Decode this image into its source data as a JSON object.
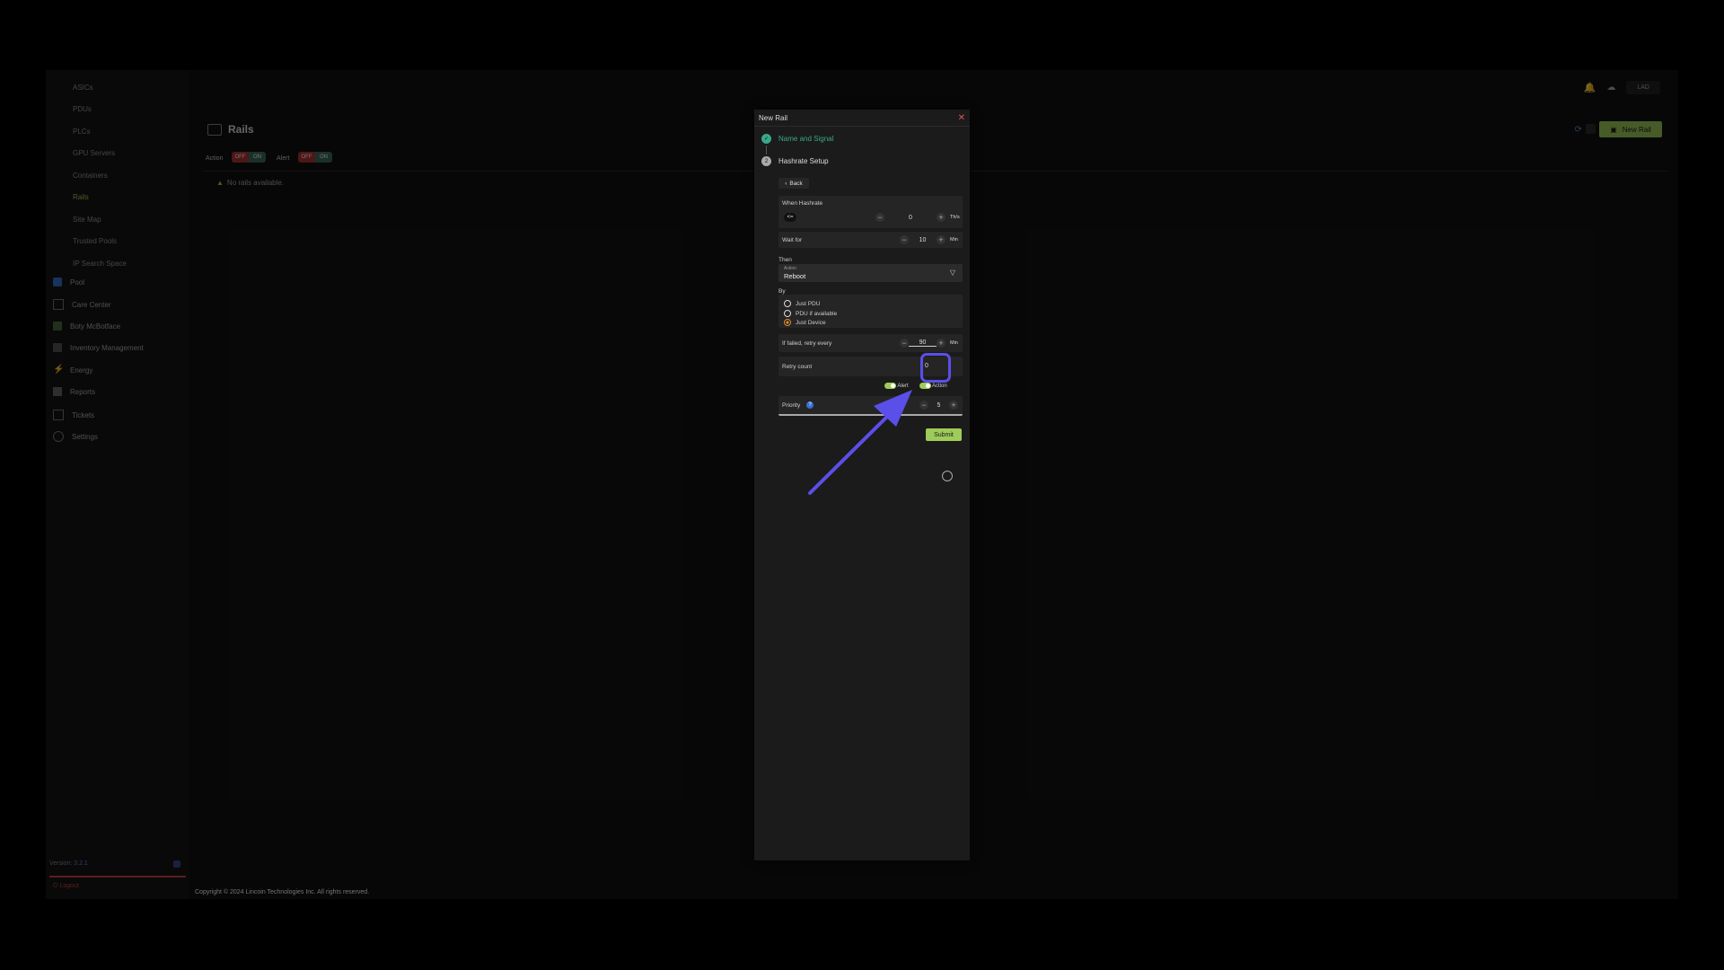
{
  "sidebar": {
    "sub_items": [
      "ASICs",
      "PDUs",
      "PLCs",
      "GPU Servers",
      "Containers",
      "Rails",
      "Site Map",
      "Trusted Pools",
      "IP Search Space"
    ],
    "active_item": "Rails",
    "sections": [
      "Pool",
      "Care Center",
      "Boty McBotface",
      "Inventory Management",
      "Energy",
      "Reports",
      "Tickets",
      "Settings"
    ],
    "version_label": "Version",
    "version": "3.2.1",
    "logout": "Logout",
    "copyright": "Copyright © 2024 Lincoin Technologies Inc. All rights reserved."
  },
  "main": {
    "title": "Rails",
    "filters": [
      {
        "label": "Action",
        "off": "OFF",
        "on": "ON"
      },
      {
        "label": "Alert",
        "off": "OFF",
        "on": "ON"
      }
    ],
    "empty": "No rails available.",
    "new_rail_button": "New Rail",
    "user": "LAD"
  },
  "modal": {
    "title": "New Rail",
    "steps": [
      {
        "label": "Name and Signal",
        "state": "done"
      },
      {
        "label": "Hashrate Setup",
        "state": "current"
      }
    ],
    "back": "Back",
    "when_hashrate_label": "When Hashrate",
    "operator": "<=",
    "hashrate_value": "0",
    "hashrate_unit": "Th/s",
    "wait_for_label": "Wait for",
    "wait_value": "10",
    "wait_unit": "Min",
    "then_label": "Then",
    "action_label": "Action",
    "action_value": "Reboot",
    "by_label": "By",
    "by_options": [
      "Just PDU",
      "PDU if available",
      "Just Device"
    ],
    "by_selected": "Just Device",
    "retry_every_label": "If failed, retry every",
    "retry_every_value": "90",
    "retry_every_unit": "Min",
    "retry_count_label": "Retry count",
    "retry_count_value": "0",
    "alert_toggle": "Alert",
    "action_toggle": "Action",
    "priority_label": "Priority",
    "priority_value": "5",
    "submit": "Submit"
  },
  "colors": {
    "accent": "#9ecb5a",
    "annotation": "#5b4fe9",
    "danger": "#e05353"
  }
}
